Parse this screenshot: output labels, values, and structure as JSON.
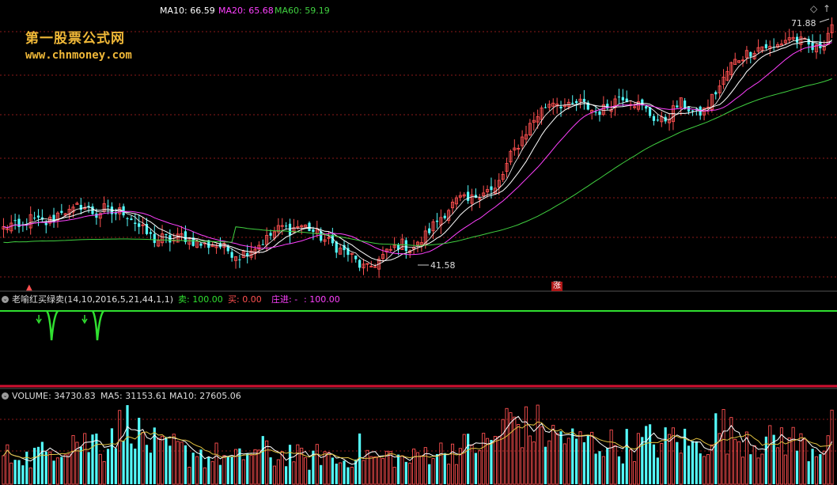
{
  "colors": {
    "background": "#000000",
    "up": "#ff5050",
    "down": "#54fcfc",
    "ma10": "#ffffff",
    "ma20": "#ff40ff",
    "ma60": "#40d040",
    "grid": "#8b1a1a",
    "signal": "#30e030",
    "divider": "#d01030"
  },
  "watermark": {
    "title": "第一股票公式网",
    "url": "www.chnmoney.com"
  },
  "price_panel": {
    "legend": [
      {
        "label": "MA10: 66.59",
        "color": "#ffffff"
      },
      {
        "label": "MA20: 65.68",
        "color": "#ff40ff"
      },
      {
        "label": "MA60: 59.19",
        "color": "#40d040"
      }
    ],
    "high_label": "71.88",
    "low_label": "41.58",
    "rise_badge": "涨",
    "corner_icon": "diamond-icon",
    "marker_icon": "up-arrow-marker-icon"
  },
  "indicator_panel": {
    "title": "老喻红买绿卖(14,10,2016,5,21,44,1,1)",
    "sell": "卖: 100.00",
    "buy": "买: 0.00",
    "dealer_prefix": "庄进: -",
    "dealer_value": ": 100.00",
    "toggle_icon": "collapse-circle-icon"
  },
  "volume_panel": {
    "title": "VOLUME: 34730.83",
    "ma5": "MA5: 31153.61",
    "ma10": "MA10: 27605.06",
    "toggle_icon": "collapse-circle-icon"
  },
  "chart_data": {
    "type": "candlestick",
    "price_range": [
      41.58,
      71.88
    ],
    "close_path": [
      47,
      47.5,
      46.8,
      48.2,
      47.9,
      47.6,
      48.3,
      49.4,
      48.8,
      49.9,
      49.3,
      48.6,
      49.5,
      48.7,
      49.2,
      48.4,
      47.2,
      46.3,
      45.5,
      45.9,
      45.4,
      46.1,
      45.7,
      45.1,
      44.9,
      45.2,
      44.6,
      44.1,
      43.7,
      44.4,
      44.9,
      45.6,
      46.5,
      47.2,
      46.8,
      47.4,
      47.1,
      46.3,
      45.6,
      45.0,
      44.3,
      43.8,
      42.6,
      42.0,
      42.8,
      43.7,
      44.5,
      45.2,
      44.6,
      44.9,
      46.3,
      47.6,
      48.7,
      49.8,
      50.6,
      50.2,
      51.1,
      51.8,
      51.3,
      53.4,
      55.8,
      57.4,
      59.1,
      60.6,
      61.8,
      62.6,
      62.1,
      61.6,
      62.4,
      61.8,
      61.1,
      61.5,
      62.2,
      63.3,
      62.7,
      62.1,
      61.3,
      60.4,
      59.9,
      61.1,
      62.3,
      61.6,
      60.8,
      61.4,
      63.2,
      64.7,
      66.8,
      67.7,
      68.3,
      68.9,
      69.2,
      68.7,
      69.6,
      70.3,
      69.8,
      69.4,
      68.6,
      69.6,
      71.9
    ],
    "volume_range": [
      0,
      100000
    ],
    "volume_path": [
      38000,
      32000,
      45000,
      28000,
      41000,
      36000,
      52000,
      47000,
      60000,
      55000,
      49000,
      58000,
      44000,
      74000,
      66000,
      93000,
      61000,
      52000,
      48000,
      40000,
      46000,
      42000,
      35000,
      44000,
      30000,
      37000,
      34000,
      29000,
      33000,
      41000,
      38000,
      44000,
      31000,
      36000,
      40000,
      33000,
      28000,
      35000,
      39000,
      30000,
      27000,
      34000,
      45000,
      38000,
      29000,
      33000,
      36000,
      31000,
      28000,
      35000,
      40000,
      44000,
      38000,
      46000,
      42000,
      48000,
      51000,
      47000,
      56000,
      70000,
      82000,
      76000,
      68000,
      72000,
      64000,
      58000,
      62000,
      55000,
      50000,
      57000,
      48000,
      53000,
      49000,
      45000,
      51000,
      47000,
      56000,
      52000,
      48000,
      60000,
      55000,
      50000,
      46000,
      54000,
      66000,
      72000,
      60000,
      58000,
      64000,
      52000,
      56000,
      49000,
      61000,
      55000,
      51000,
      47000,
      44000,
      52000,
      83000
    ],
    "ma10_label": "MA10: 66.59",
    "ma20_label": "MA20: 65.68",
    "ma60_label": "MA60: 59.19",
    "volume_label": "VOLUME: 34730.83",
    "volume_ma5_label": "MA5: 31153.61",
    "volume_ma10_label": "MA10: 27605.06",
    "signal_dips": [
      0.06,
      0.115
    ]
  }
}
